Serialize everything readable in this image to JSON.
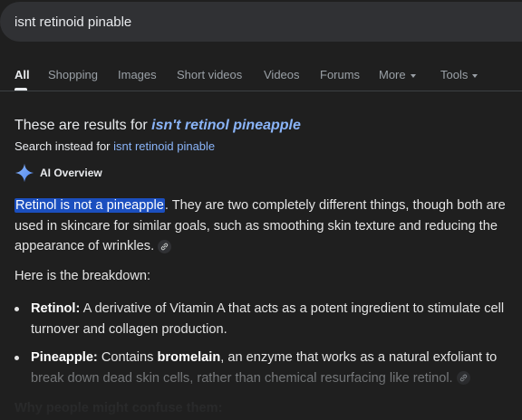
{
  "search": {
    "query": "isnt retinoid pinable"
  },
  "tabs": [
    {
      "label": "All",
      "active": true
    },
    {
      "label": "Shopping"
    },
    {
      "label": "Images"
    },
    {
      "label": "Short videos"
    },
    {
      "label": "Videos"
    },
    {
      "label": "Forums"
    },
    {
      "label": "More"
    },
    {
      "label": "Tools"
    }
  ],
  "correction": {
    "prefix": "These are results for ",
    "corrected_query": "isn't retinol pineapple",
    "instead_prefix": "Search instead for ",
    "original_query": "isnt retinoid pinable"
  },
  "ai_overview": {
    "label": "AI Overview",
    "highlight": "Retinol is not a pineapple",
    "para1_rest": ". They are two completely different things, though both are used in skincare for similar goals, such as smoothing skin texture and reducing the appearance of wrinkles.",
    "para2": "Here is the breakdown:",
    "bullets": [
      {
        "term": "Retinol:",
        "text": " A derivative of Vitamin A that acts as a potent ingredient to stimulate cell turnover and collagen production."
      },
      {
        "term": "Pineapple:",
        "text_a": " Contains ",
        "bold": "bromelain",
        "text_b": ", an enzyme that works as a natural exfoliant to",
        "text_faded": "break down dead skin cells, rather than chemical resurfacing like retinol."
      }
    ],
    "next_heading": "Why people might confuse them:"
  },
  "colors": {
    "background": "#1f1f1f",
    "link": "#8ab4f8",
    "highlight": "#1b4fbf"
  },
  "icons": [
    "gemini-sparkle-icon",
    "link-icon",
    "caret-down-icon"
  ]
}
